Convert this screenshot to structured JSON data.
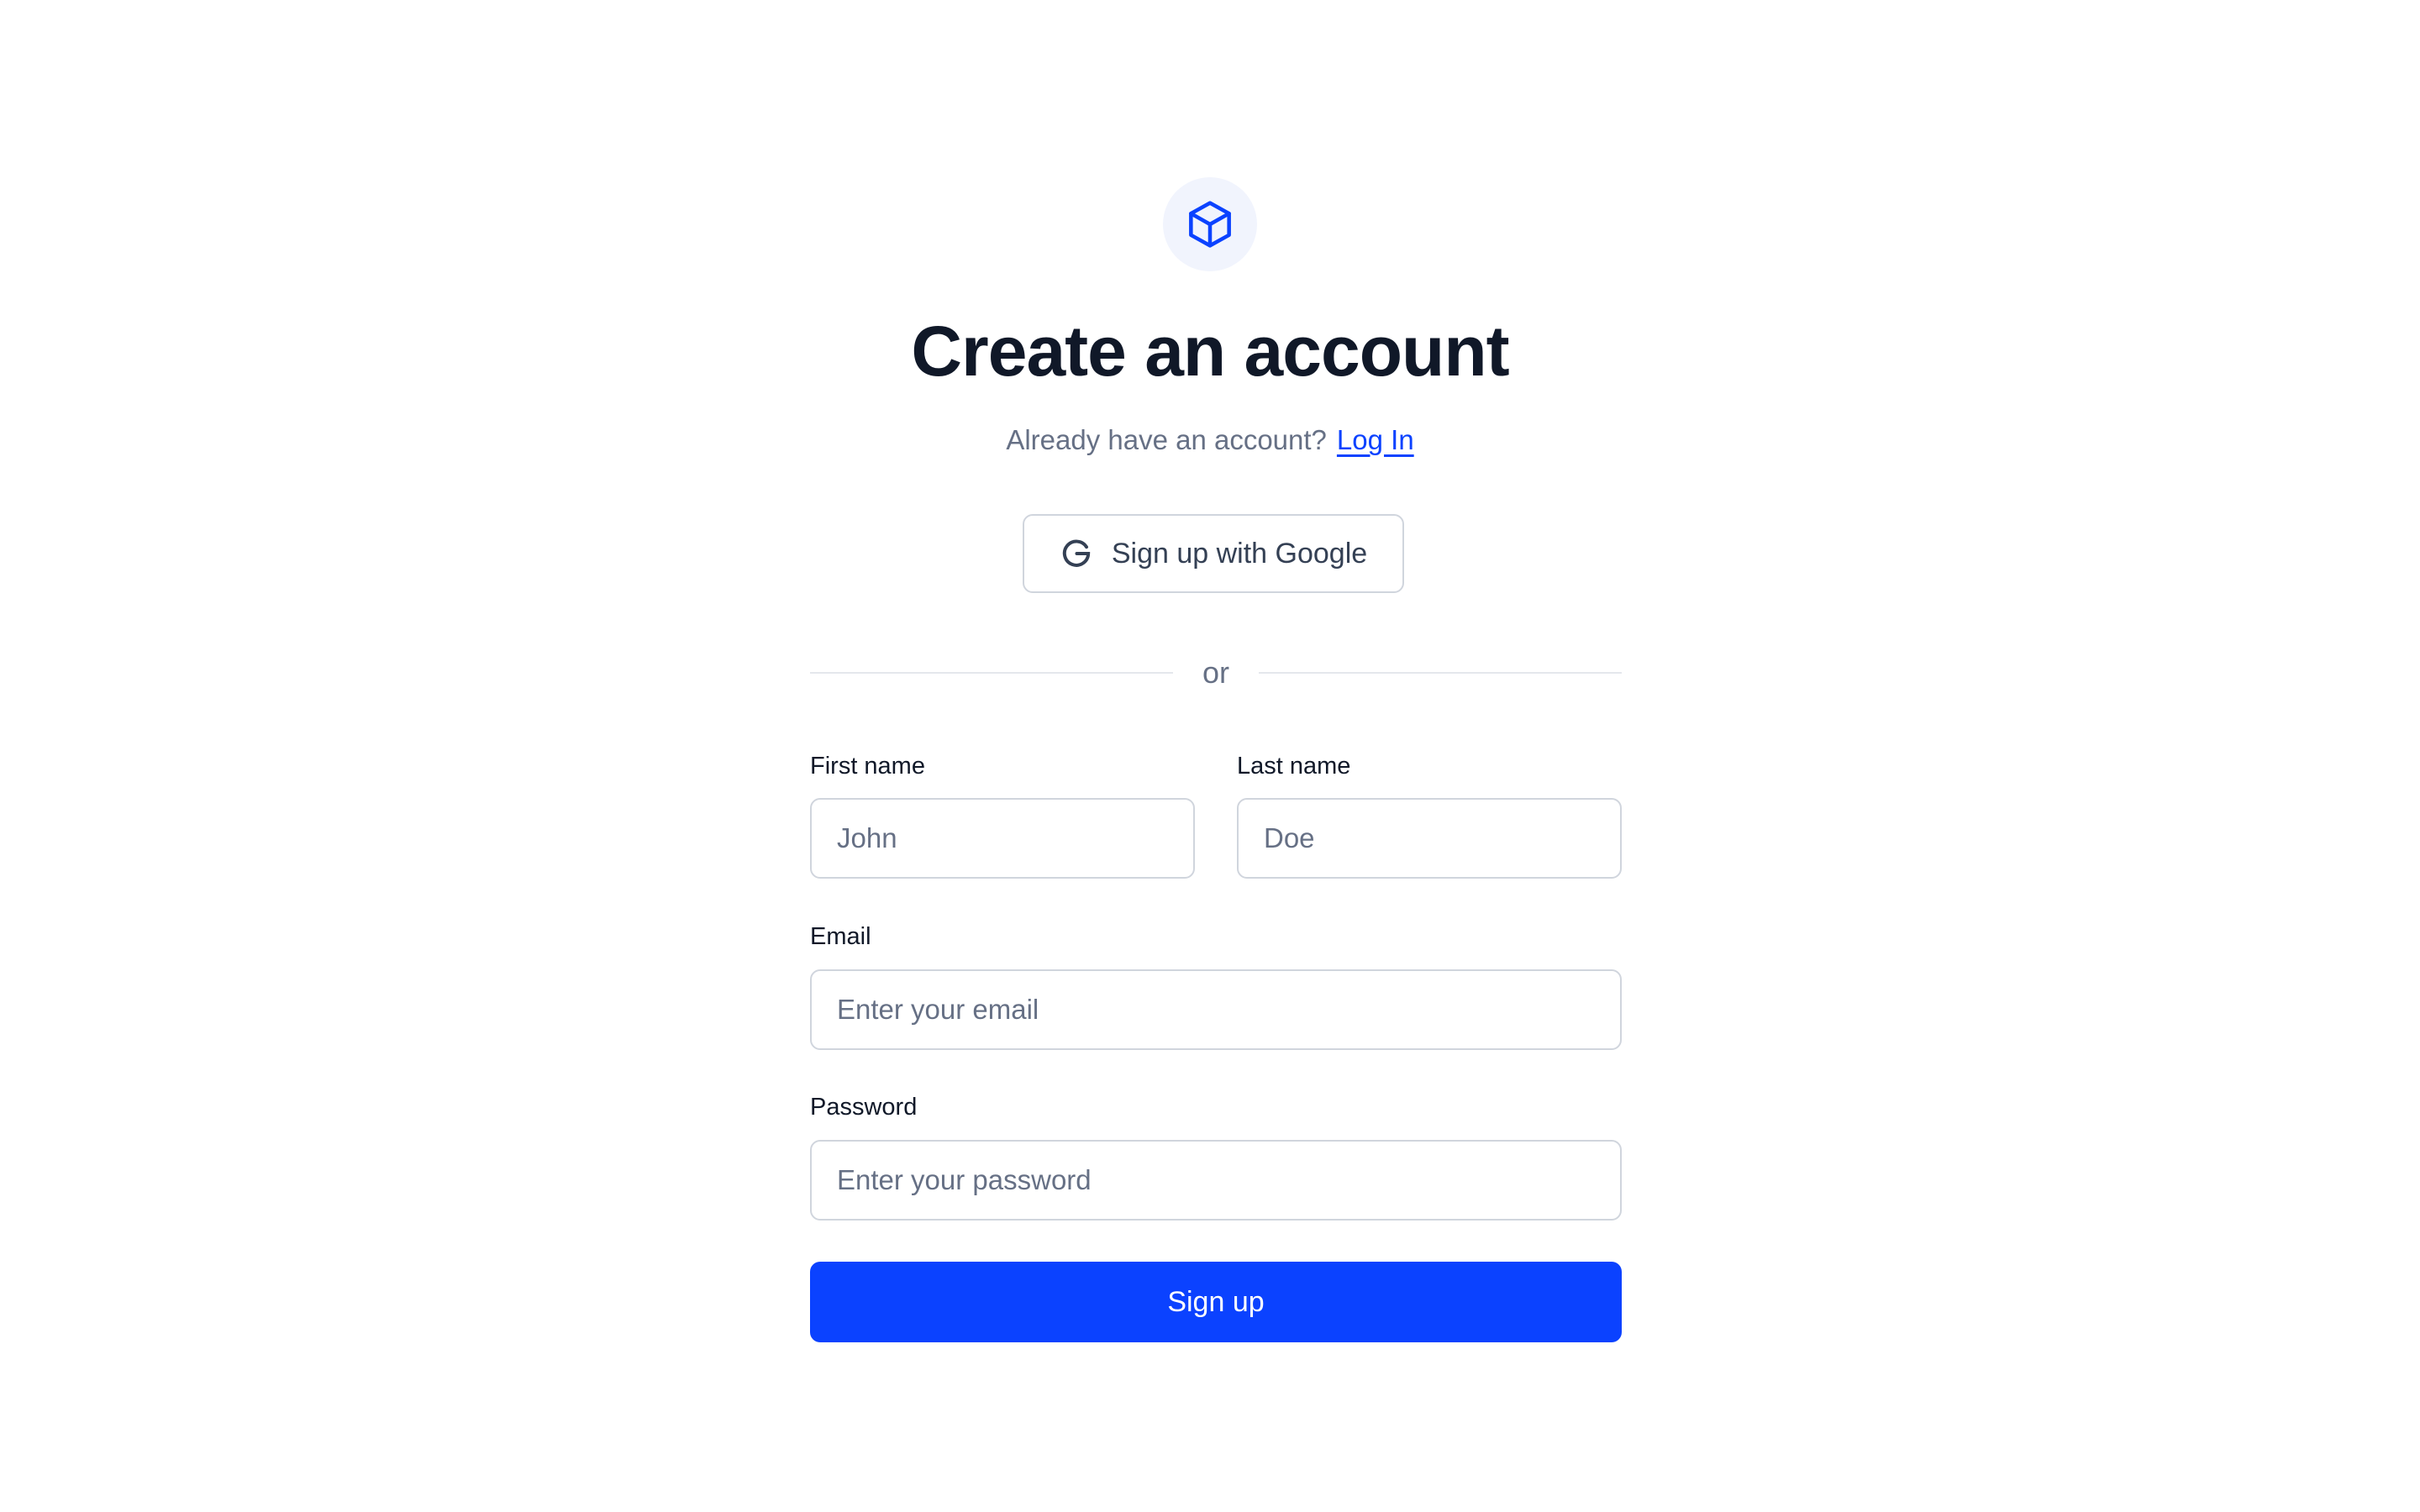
{
  "header": {
    "logo_icon": "cube-icon",
    "title": "Create an account",
    "subtitle_prefix": "Already have an account?",
    "login_link": "Log In"
  },
  "oauth": {
    "google_icon": "google-g-icon",
    "google_label": "Sign up with Google"
  },
  "divider": {
    "text": "or"
  },
  "form": {
    "first_name": {
      "label": "First name",
      "placeholder": "John",
      "value": ""
    },
    "last_name": {
      "label": "Last name",
      "placeholder": "Doe",
      "value": ""
    },
    "email": {
      "label": "Email",
      "placeholder": "Enter your email",
      "value": ""
    },
    "password": {
      "label": "Password",
      "placeholder": "Enter your password",
      "value": ""
    },
    "submit_label": "Sign up"
  },
  "colors": {
    "accent": "#0b42ff",
    "heading": "#101828",
    "muted_text": "#667085",
    "border": "#d0d5dd",
    "logo_bg": "#f1f4fd"
  }
}
